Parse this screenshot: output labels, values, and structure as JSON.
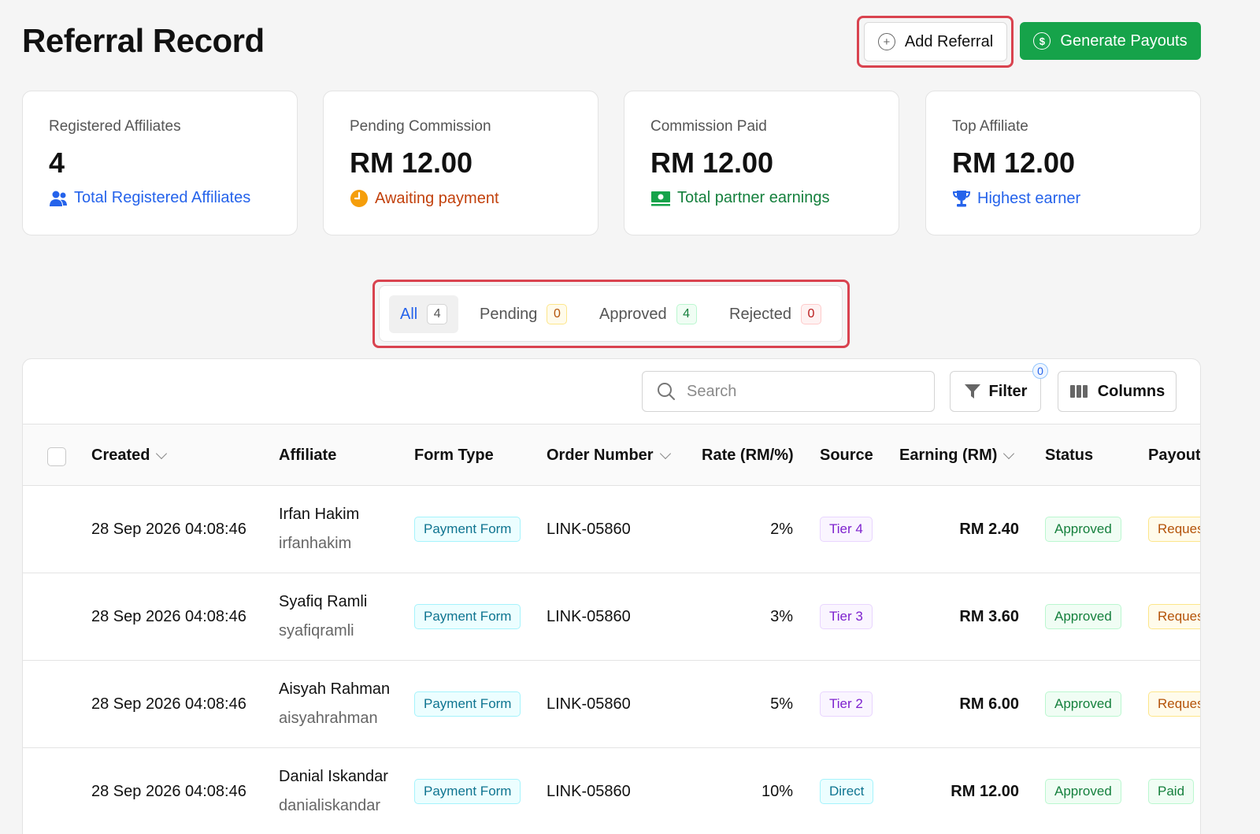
{
  "header": {
    "title": "Referral Record",
    "add_label": "Add Referral",
    "generate_label": "Generate Payouts"
  },
  "cards": [
    {
      "label": "Registered Affiliates",
      "value": "4",
      "foot": "Total Registered Affiliates",
      "icon": "users-icon"
    },
    {
      "label": "Pending Commission",
      "value": "RM 12.00",
      "foot": "Awaiting payment",
      "icon": "clock-icon"
    },
    {
      "label": "Commission Paid",
      "value": "RM 12.00",
      "foot": "Total partner earnings",
      "icon": "money-icon"
    },
    {
      "label": "Top Affiliate",
      "value": "RM 12.00",
      "foot": "Highest earner",
      "icon": "trophy-icon"
    }
  ],
  "tabs": [
    {
      "label": "All",
      "count": "4"
    },
    {
      "label": "Pending",
      "count": "0"
    },
    {
      "label": "Approved",
      "count": "4"
    },
    {
      "label": "Rejected",
      "count": "0"
    }
  ],
  "toolbar": {
    "search_placeholder": "Search",
    "filter_label": "Filter",
    "filter_count": "0",
    "columns_label": "Columns"
  },
  "columns": [
    "Created",
    "Affiliate",
    "Form Type",
    "Order Number",
    "Rate (RM/%)",
    "Source",
    "Earning (RM)",
    "Status",
    "Payout"
  ],
  "rows": [
    {
      "created": "28 Sep 2026 04:08:46",
      "name": "Irfan Hakim",
      "username": "irfanhakim",
      "form": "Payment Form",
      "order": "LINK-05860",
      "rate": "2%",
      "source": "Tier 4",
      "earning": "RM 2.40",
      "status": "Approved",
      "payout": "Reques"
    },
    {
      "created": "28 Sep 2026 04:08:46",
      "name": "Syafiq Ramli",
      "username": "syafiqramli",
      "form": "Payment Form",
      "order": "LINK-05860",
      "rate": "3%",
      "source": "Tier 3",
      "earning": "RM 3.60",
      "status": "Approved",
      "payout": "Reques"
    },
    {
      "created": "28 Sep 2026 04:08:46",
      "name": "Aisyah Rahman",
      "username": "aisyahrahman",
      "form": "Payment Form",
      "order": "LINK-05860",
      "rate": "5%",
      "source": "Tier 2",
      "earning": "RM 6.00",
      "status": "Approved",
      "payout": "Reques"
    },
    {
      "created": "28 Sep 2026 04:08:46",
      "name": "Danial Iskandar",
      "username": "danialiskandar",
      "form": "Payment Form",
      "order": "LINK-05860",
      "rate": "10%",
      "source": "Direct",
      "earning": "RM 12.00",
      "status": "Approved",
      "payout": "Paid"
    }
  ],
  "colors": {
    "primary_green": "#16a34a",
    "highlight_red": "#d9434f",
    "link_blue": "#2563eb"
  }
}
